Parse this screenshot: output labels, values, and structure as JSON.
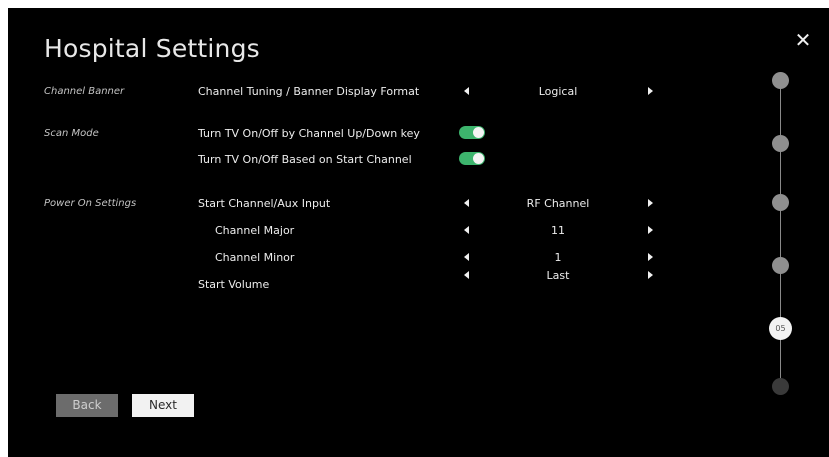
{
  "title": "Hospital Settings",
  "close_label": "✕",
  "sections": {
    "channel_banner": "Channel Banner",
    "scan_mode": "Scan Mode",
    "power_on": "Power On Settings"
  },
  "rows": {
    "banner_format": {
      "label": "Channel Tuning / Banner Display Format",
      "value": "Logical"
    },
    "tv_onoff_updown": {
      "label": "Turn TV On/Off by Channel Up/Down key",
      "toggle": true
    },
    "tv_onoff_start": {
      "label": "Turn TV On/Off Based on Start Channel",
      "toggle": true
    },
    "start_channel": {
      "label": "Start Channel/Aux Input",
      "value": "RF Channel"
    },
    "channel_major": {
      "label": "Channel Major",
      "value": "11"
    },
    "channel_minor": {
      "label": "Channel Minor",
      "value": "1"
    },
    "start_volume": {
      "label": "Start Volume",
      "value": "Last"
    }
  },
  "buttons": {
    "back": "Back",
    "next": "Next"
  },
  "stepper": {
    "current_step": "05",
    "total_steps": 6
  },
  "colors": {
    "background": "#000000",
    "toggle_on": "#3db46d",
    "step_done": "#8f8f8f",
    "step_current": "#f2f2f2",
    "step_future": "#3a3a3a"
  }
}
